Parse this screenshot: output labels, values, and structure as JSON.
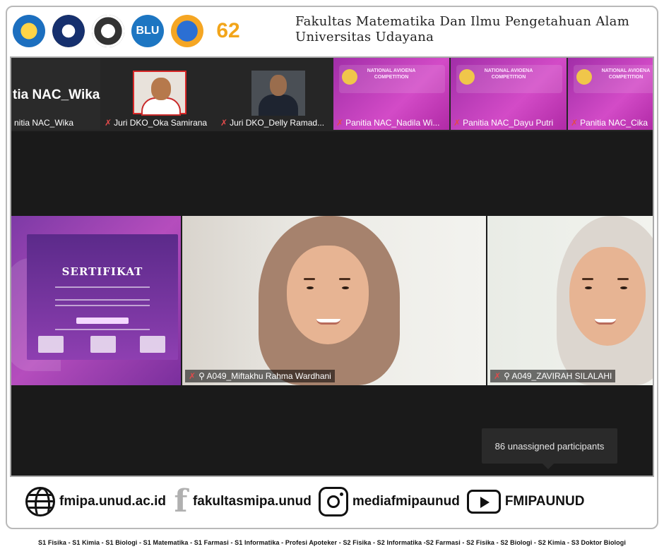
{
  "header": {
    "faculty_line1": "Fakultas Matematika Dan Ilmu Pengetahuan Alam",
    "faculty_line2": "Universitas Udayana",
    "logos": [
      "tut-wuri-handayani-logo",
      "universitas-udayana-logo",
      "fmipa-logo",
      "blu-logo",
      "diktisaintek-berdampak-logo",
      "anniversary-62-logo"
    ],
    "logo_texts": {
      "blu": "BLU",
      "anniv": "62"
    }
  },
  "meeting": {
    "strip_tiles": [
      {
        "big_label": "tia NAC_Wika",
        "name": "nitia NAC_Wika",
        "muted": false
      },
      {
        "name": "Juri DKO_Oka Samirana",
        "muted": true
      },
      {
        "name": "Juri DKO_Delly Ramad...",
        "muted": true
      },
      {
        "name": "Panitia NAC_Nadila Wi...",
        "muted": true,
        "banner": "NATIONAL AVIOENA COMPETITION"
      },
      {
        "name": "Panitia NAC_Dayu Putri",
        "muted": true,
        "banner": "NATIONAL AVIOENA COMPETITION"
      },
      {
        "name": "Panitia NAC_Cika",
        "muted": true,
        "banner": "NATIONAL AVIOENA COMPETITION"
      }
    ],
    "gallery_tiles": [
      {
        "certificate_title": "SERTIFIKAT"
      },
      {
        "name": "A049_Miftakhu Rahma Wardhani",
        "muted": true
      },
      {
        "name": "A049_ZAVIRAH SILALAHI",
        "muted": true
      }
    ],
    "unassigned_tooltip": "86 unassigned participants"
  },
  "footer": {
    "website": "fmipa.unud.ac.id",
    "facebook": "fakultasmipa.unud",
    "instagram": "mediafmipaunud",
    "youtube": "FMIPAUNUD",
    "programs": "S1 Fisika - S1 Kimia - S1 Biologi - S1 Matematika - S1 Farmasi - S1 Informatika - Profesi Apoteker - S2 Fisika - S2 Informatika -S2 Farmasi - S2 Fisika - S2 Biologi - S2 Kimia - S3 Doktor Biologi"
  },
  "icons": {
    "muted_mic": "✗",
    "raised": "⚲",
    "facebook_glyph": "f"
  },
  "colors": {
    "zoom_bg": "#1a1a1a",
    "muted_red": "#e24a4a",
    "nac_purple": "#b02aa6"
  }
}
